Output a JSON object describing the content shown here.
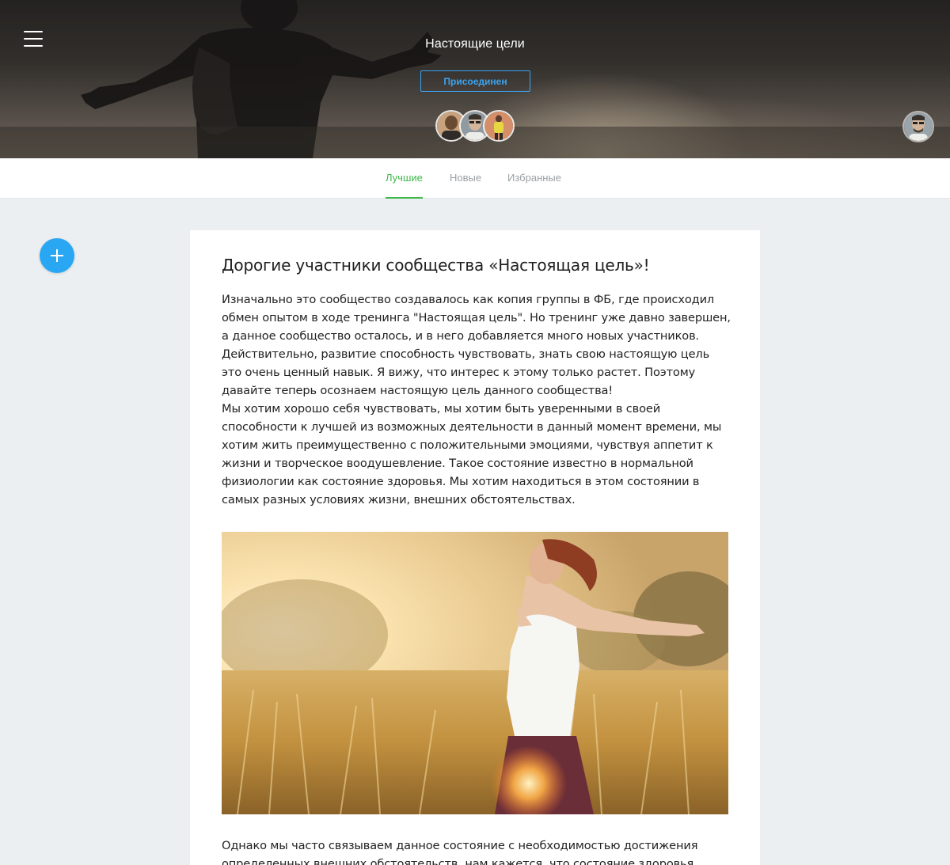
{
  "header": {
    "group_title": "Настоящие цели",
    "join_label": "Присоединен",
    "members": [
      {
        "avatar": "member-avatar-1"
      },
      {
        "avatar": "member-avatar-2"
      },
      {
        "avatar": "member-avatar-3"
      }
    ],
    "current_user_avatar": "user-avatar",
    "menu_icon": "hamburger-menu-icon"
  },
  "tabs": [
    {
      "label": "Лучшие",
      "active": true
    },
    {
      "label": "Новые",
      "active": false
    },
    {
      "label": "Избранные",
      "active": false
    }
  ],
  "fab": {
    "icon": "plus-icon"
  },
  "post": {
    "title": "Дорогие участники сообщества «Настоящая цель»!",
    "paragraph_1": "Изначально это сообщество создавалось как копия группы в ФБ, где происходил обмен опытом в ходе тренинга \"Настоящая цель\". Но тренинг уже давно завершен, а данное сообщество осталось, и в него добавляется много новых участников. Действительно, развитие способность чувствовать, знать свою настоящую цель  это очень ценный навык. Я вижу, что интерес к этому только растет. Поэтому давайте теперь осознаем настоящую цель данного сообщества!",
    "paragraph_2": "Мы хотим хорошо себя чувствовать, мы хотим быть уверенными в своей способности к лучшей из возможных деятельности в данный момент времени, мы хотим жить преимущественно с положительными эмоциями, чувствуя аппетит к жизни и творческое воодушевление. Такое состояние известно в нормальной физиологии как состояние здоровья. Мы хотим находиться в этом состоянии в самых разных условиях жизни, внешних обстоятельствах.",
    "paragraph_3": "Однако мы часто связываем данное состояние с необходимостью достижения определенных внешних обстоятельств, нам кажется, что состояние здоровья"
  },
  "colors": {
    "accent_blue": "#2aa7f3",
    "active_tab_green": "#3fb84a",
    "page_background": "#eceff1"
  }
}
